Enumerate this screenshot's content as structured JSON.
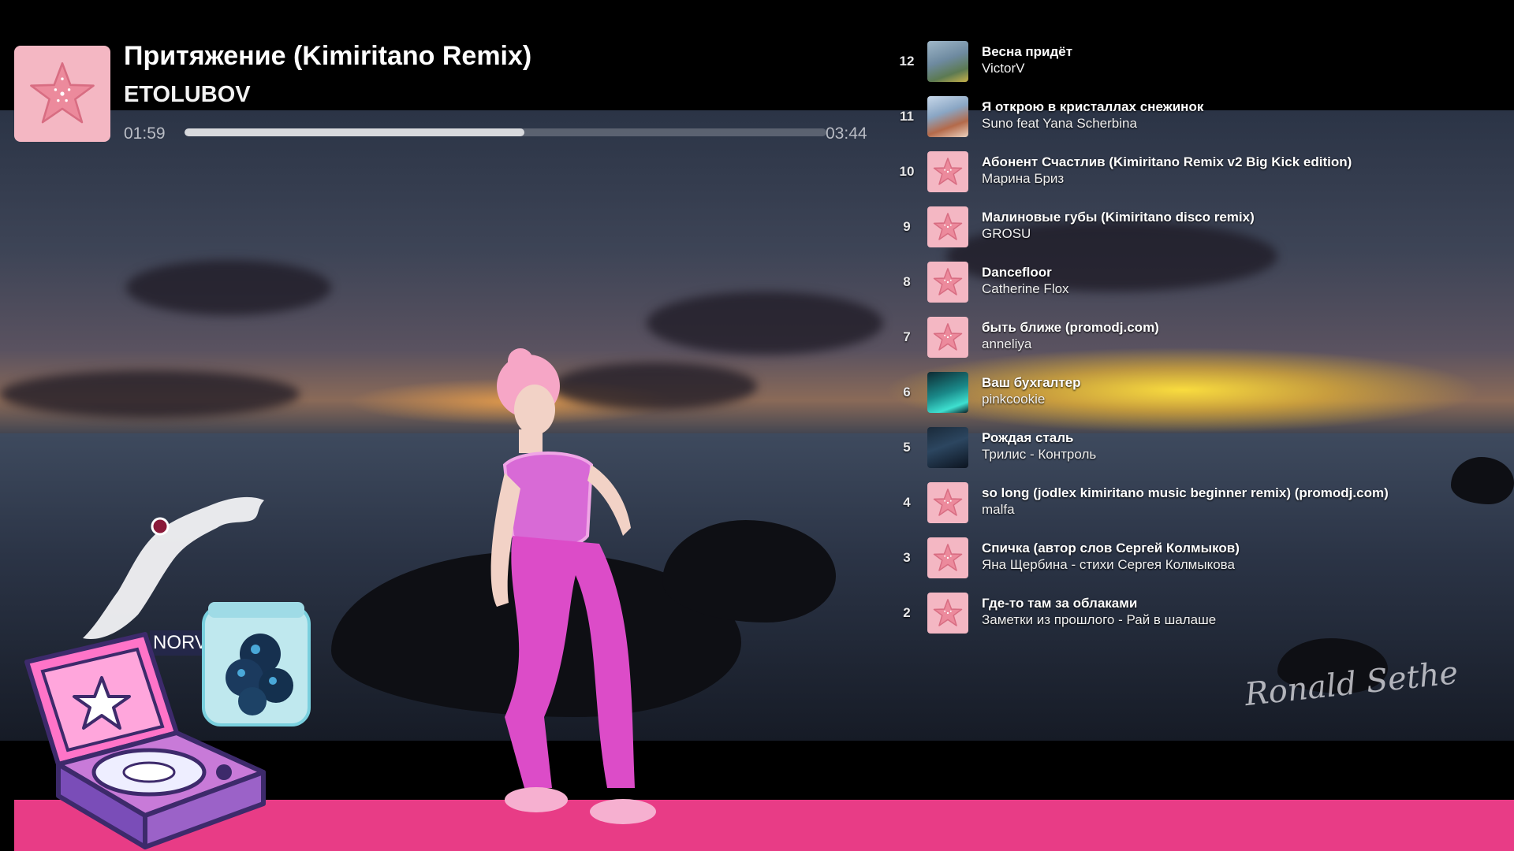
{
  "now_playing": {
    "title": "Притяжение (Kimiritano Remix)",
    "artist": "ETOLUBOV",
    "elapsed": "01:59",
    "duration": "03:44",
    "progress": 0.53
  },
  "playlist": [
    {
      "num": "12",
      "title": "Весна придёт",
      "artist": "VictorV",
      "thumb": "photo-landscape"
    },
    {
      "num": "11",
      "title": "Я открою в кристаллах снежинок",
      "artist": "Suno feat Yana Scherbina",
      "thumb": "photo-girl"
    },
    {
      "num": "10",
      "title": "Абонент Счастлив (Kimiritano Remix v2 Big Kick edition)",
      "artist": "Марина Бриз",
      "thumb": "star"
    },
    {
      "num": "9",
      "title": "Малиновые губы (Kimiritano disco remix)",
      "artist": "GROSU",
      "thumb": "star"
    },
    {
      "num": "8",
      "title": "Dancefloor",
      "artist": "Catherine Flox",
      "thumb": "star"
    },
    {
      "num": "7",
      "title": "быть ближе (promodj.com)",
      "artist": "anneliya",
      "thumb": "star"
    },
    {
      "num": "6",
      "title": "Ваш бухгалтер",
      "artist": "pinkcookie",
      "thumb": "photo-teal"
    },
    {
      "num": "5",
      "title": "Рождая сталь",
      "artist": "Трилис - Контроль",
      "thumb": "photo-dark"
    },
    {
      "num": "4",
      "title": "so long (jodlex kimiritano music beginner remix) (promodj.com)",
      "artist": "malfa",
      "thumb": "star"
    },
    {
      "num": "3",
      "title": "Спичка (автор слов Сергей Колмыков)",
      "artist": "Яна Щербина - стихи Сергея Колмыкова",
      "thumb": "star"
    },
    {
      "num": "2",
      "title": "Где-то там за облаками",
      "artist": "Заметки из прошлого - Рай в шалаше",
      "thumb": "star"
    }
  ],
  "overlay": {
    "map_label": "NORV",
    "signature": "Ronald Sethe"
  },
  "colors": {
    "accent_pink": "#e83c86",
    "cover_pink": "#f4b7c3",
    "star_pink": "#ec8a9c"
  }
}
